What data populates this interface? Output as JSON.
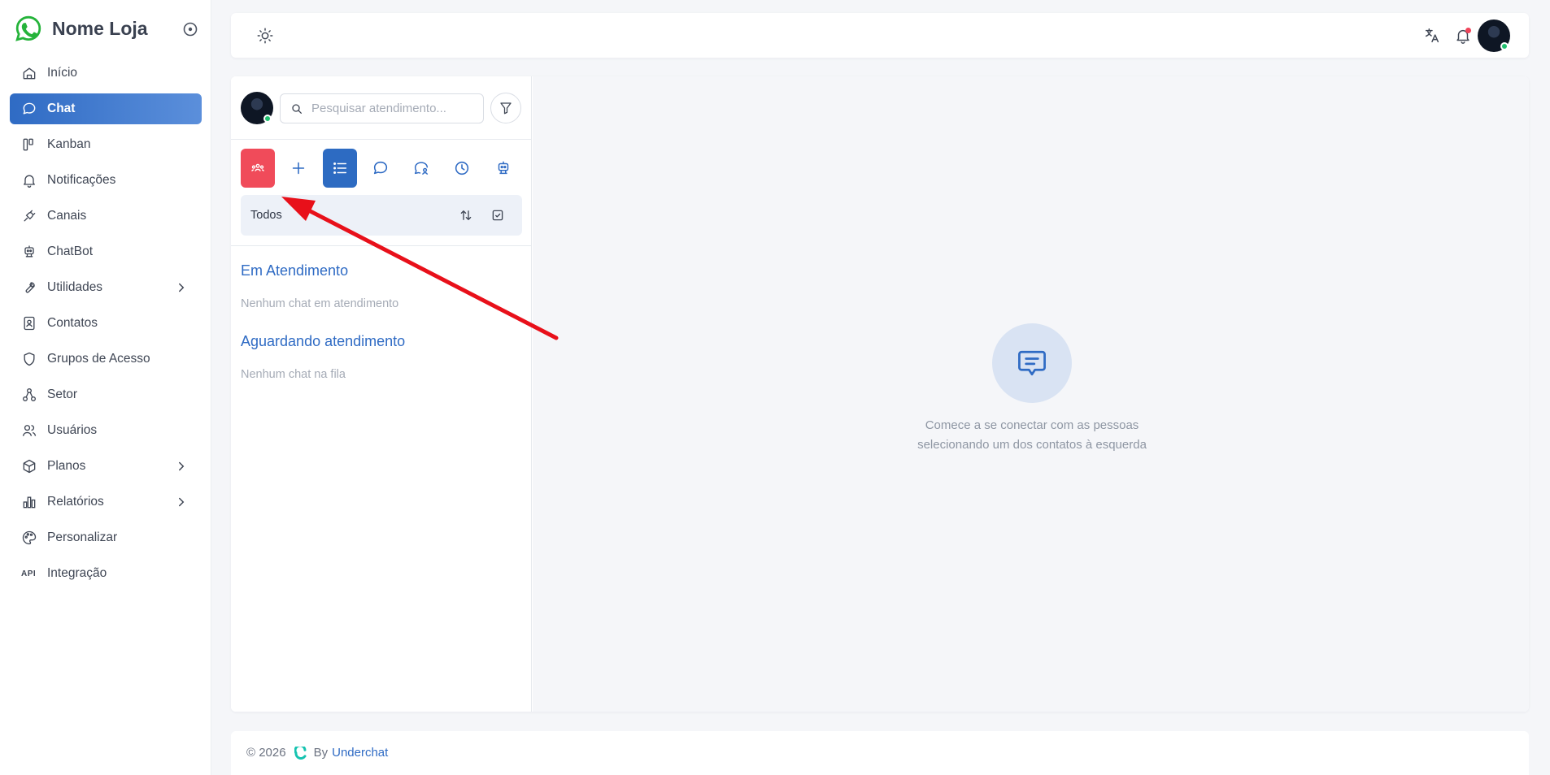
{
  "brand": {
    "title": "Nome Loja",
    "logo_icon": "whatsapp-icon",
    "logo_color": "#25b33a"
  },
  "sidebar": {
    "items": [
      {
        "label": "Início",
        "icon": "home-icon",
        "active": false
      },
      {
        "label": "Chat",
        "icon": "chat-bubble-icon",
        "active": true
      },
      {
        "label": "Kanban",
        "icon": "kanban-icon",
        "active": false
      },
      {
        "label": "Notificações",
        "icon": "bell-icon",
        "active": false
      },
      {
        "label": "Canais",
        "icon": "plug-icon",
        "active": false
      },
      {
        "label": "ChatBot",
        "icon": "robot-icon",
        "active": false
      },
      {
        "label": "Utilidades",
        "icon": "wrench-icon",
        "active": false,
        "expandable": true
      },
      {
        "label": "Contatos",
        "icon": "contacts-book-icon",
        "active": false
      },
      {
        "label": "Grupos de Acesso",
        "icon": "shield-icon",
        "active": false
      },
      {
        "label": "Setor",
        "icon": "hierarchy-icon",
        "active": false
      },
      {
        "label": "Usuários",
        "icon": "users-icon",
        "active": false
      },
      {
        "label": "Planos",
        "icon": "package-icon",
        "active": false,
        "expandable": true
      },
      {
        "label": "Relatórios",
        "icon": "bar-chart-icon",
        "active": false,
        "expandable": true
      },
      {
        "label": "Personalizar",
        "icon": "palette-icon",
        "active": false
      },
      {
        "label": "Integração",
        "icon": "api-icon",
        "icon_text": "API",
        "active": false
      }
    ]
  },
  "topbar": {
    "icons": [
      "sun-icon",
      "translate-icon",
      "bell-icon",
      "user-avatar"
    ]
  },
  "chat_panel": {
    "search": {
      "placeholder": "Pesquisar atendimento...",
      "value": ""
    },
    "toolbar_icons": [
      "group-icon",
      "plus-icon",
      "list-icon",
      "chat-bubble-icon",
      "chat-user-icon",
      "clock-icon",
      "robot-icon"
    ],
    "filter_label": "Todos",
    "sections": [
      {
        "title": "Em Atendimento",
        "empty": "Nenhum chat em atendimento"
      },
      {
        "title": "Aguardando atendimento",
        "empty": "Nenhum chat na fila"
      }
    ]
  },
  "empty_state": {
    "icon": "message-square-icon",
    "line1": "Comece a se conectar com as pessoas",
    "line2": "selecionando um dos contatos à esquerda"
  },
  "footer": {
    "copyright": "© 2026",
    "by": "By",
    "link": "Underchat"
  },
  "colors": {
    "accent": "#2f6bc4",
    "danger": "#f04b5a",
    "online": "#1fbf6e",
    "annotation_arrow": "#e8101a"
  }
}
